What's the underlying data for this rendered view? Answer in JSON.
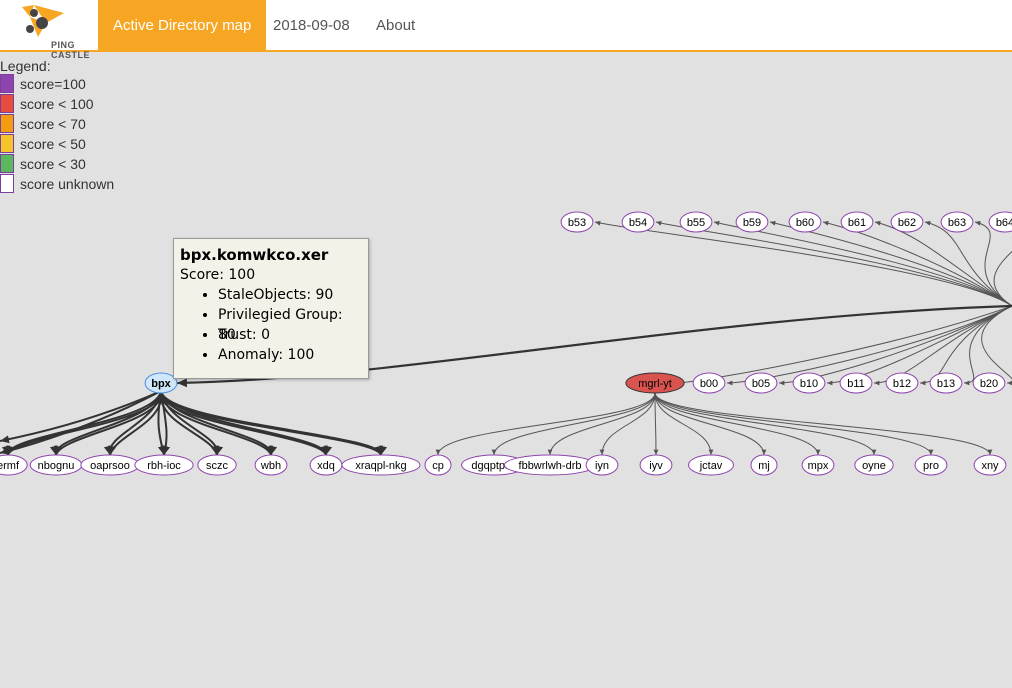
{
  "app": {
    "logo_text": "PING CASTLE",
    "nav": {
      "active_tab": "Active Directory map",
      "date": "2018-09-08",
      "about": "About"
    }
  },
  "legend": {
    "title": "Legend:",
    "items": [
      {
        "label": "score=100",
        "color": "#8e44ad"
      },
      {
        "label": "score < 100",
        "color": "#e74c3c"
      },
      {
        "label": "score < 70",
        "color": "#f39c12"
      },
      {
        "label": "score < 50",
        "color": "#f5c32c"
      },
      {
        "label": "score < 30",
        "color": "#5cb85c"
      },
      {
        "label": "score unknown",
        "color": "#ffffff"
      }
    ]
  },
  "tooltip": {
    "domain": "bpx.komwkco.xer",
    "score": "Score: 100",
    "details": [
      "StaleObjects: 90",
      "Privilegied Group: 80",
      "Trust: 0",
      "Anomaly: 100"
    ]
  },
  "graph": {
    "colors": {
      "selected_fill": "#cfe6fb",
      "selected_stroke": "#4a90d9",
      "red_fill": "#d9534f",
      "default_fill": "#ffffff",
      "default_stroke": "#8e44ad",
      "edge": "#555555"
    },
    "top_row": [
      "b53",
      "b54",
      "b55",
      "b59",
      "b60",
      "b61",
      "b62",
      "b63",
      "b64"
    ],
    "right_row": [
      "b00",
      "b05",
      "b10",
      "b11",
      "b12",
      "b13",
      "b20"
    ],
    "bpx": {
      "label": "bpx"
    },
    "bpx_children": [
      "ermf",
      "nbognu",
      "oaprsoo",
      "rbh-ioc",
      "sczc",
      "wbh",
      "xdq",
      "xraqpl-nkg"
    ],
    "mgrl": {
      "label": "mgrl-yt"
    },
    "mgrl_children": [
      "cp",
      "dgqptpax",
      "fbbwrlwh-drb",
      "iyn",
      "iyv",
      "jctav",
      "mj",
      "mpx",
      "oyne",
      "pro",
      "xny"
    ]
  }
}
